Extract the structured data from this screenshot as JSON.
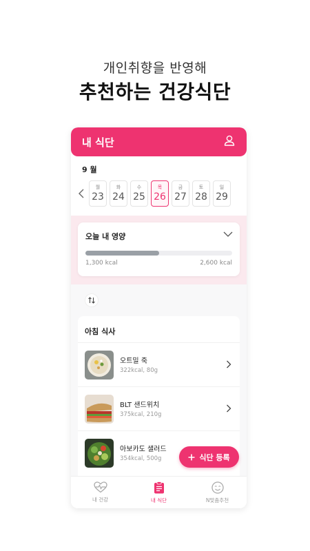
{
  "promo": {
    "subtitle": "개인취향을 반영해",
    "title_plain": "추천하는 ",
    "title_highlight": "건강식단"
  },
  "header": {
    "title": "내 식단",
    "profile_icon": "user-icon"
  },
  "calendar": {
    "month_label": "9 월",
    "back_icon": "chevron-left-icon",
    "days": [
      {
        "name": "월",
        "num": "23",
        "selected": false
      },
      {
        "name": "화",
        "num": "24",
        "selected": false
      },
      {
        "name": "수",
        "num": "25",
        "selected": false
      },
      {
        "name": "목",
        "num": "26",
        "selected": true
      },
      {
        "name": "금",
        "num": "27",
        "selected": false
      },
      {
        "name": "토",
        "num": "28",
        "selected": false
      },
      {
        "name": "일",
        "num": "29",
        "selected": false
      }
    ]
  },
  "nutrition": {
    "title": "오늘 내 영양",
    "current_kcal": "1,300 kcal",
    "target_kcal": "2,600 kcal",
    "progress_fraction": 0.5
  },
  "meal": {
    "sort_icon": "sort-icon",
    "title": "아침 식사",
    "items": [
      {
        "name": "오트밀 죽",
        "meta": "322kcal,  80g"
      },
      {
        "name": "BLT 샌드위치",
        "meta": "375kcal,  210g"
      },
      {
        "name": "아보카도 샐러드",
        "meta": "354kcal,  500g"
      }
    ]
  },
  "fab": {
    "label": "식단 등록",
    "icon": "plus-icon"
  },
  "nav": {
    "items": [
      {
        "label": "내 건강",
        "icon": "heart-pulse-icon",
        "active": false
      },
      {
        "label": "내 식단",
        "icon": "clipboard-icon",
        "active": true
      },
      {
        "label": "N맞춤추천",
        "icon": "smile-face-icon",
        "active": false
      }
    ]
  },
  "colors": {
    "brand": "#ee3370",
    "highlight": "#aef5f5",
    "pink_bg": "#fbe9ee"
  }
}
